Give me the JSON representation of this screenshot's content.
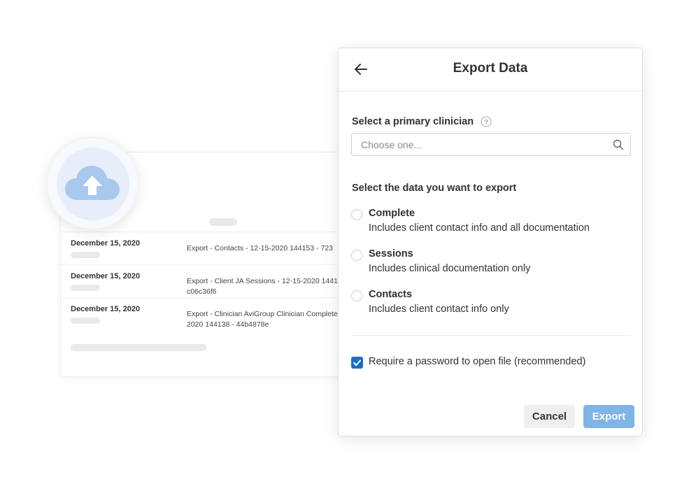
{
  "background_list": {
    "rows": [
      {
        "date": "December 15, 2020",
        "text": "Export - Contacts - 12-15-2020 144153 - 723"
      },
      {
        "date": "December 15, 2020",
        "text": "Export - Client JA Sessions - 12-15-2020 1441\nc06c36f6"
      },
      {
        "date": "December 15, 2020",
        "text": "Export - Clinician AviGroup Clinician Complete\n2020 144138 - 44b4878e"
      }
    ]
  },
  "badge": {
    "icon": "cloud-upload-icon",
    "color": "#a9c8ee"
  },
  "modal": {
    "title": "Export Data",
    "back_icon": "arrow-left-icon",
    "clinician_label": "Select a primary clinician",
    "clinician_placeholder": "Choose one...",
    "clinician_value": "",
    "data_label": "Select the data you want to export",
    "options": [
      {
        "title": "Complete",
        "description": "Includes client contact info and all documentation",
        "selected": false
      },
      {
        "title": "Sessions",
        "description": "Includes clinical documentation only",
        "selected": false
      },
      {
        "title": "Contacts",
        "description": "Includes client contact info only",
        "selected": false
      }
    ],
    "password_label": "Require a password to open file (recommended)",
    "password_checked": true,
    "cancel_label": "Cancel",
    "export_label": "Export"
  },
  "colors": {
    "accent": "#1c6fc7",
    "export_button": "#7fb4e6"
  }
}
